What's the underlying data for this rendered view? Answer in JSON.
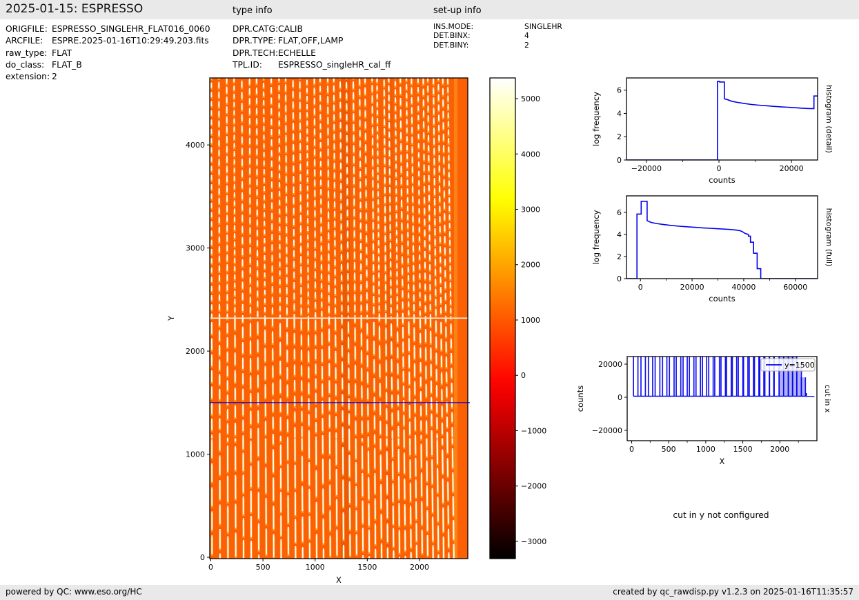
{
  "header": {
    "title": "2025-01-15: ESPRESSO",
    "type_info": "type info",
    "setup_info": "set-up info"
  },
  "file_info": {
    "rows": [
      {
        "label": "ORIGFILE:",
        "value": "ESPRESSO_SINGLEHR_FLAT016_0060"
      },
      {
        "label": "ARCFILE:",
        "value": "ESPRE.2025-01-16T10:29:49.203.fits"
      },
      {
        "label": "raw_type:",
        "value": "FLAT"
      },
      {
        "label": "do_class:",
        "value": "FLAT_B"
      },
      {
        "label": "extension:",
        "value": "2"
      }
    ]
  },
  "type_info": {
    "rows": [
      {
        "label": "DPR.CATG:",
        "value": "CALIB"
      },
      {
        "label": "DPR.TYPE:",
        "value": "FLAT,OFF,LAMP"
      },
      {
        "label": "DPR.TECH:",
        "value": "ECHELLE"
      },
      {
        "label": "TPL.ID:",
        "value": "ESPRESSO_singleHR_cal_ff"
      }
    ]
  },
  "setup_info": {
    "rows": [
      {
        "label": "INS.MODE:",
        "value": "SINGLEHR"
      },
      {
        "label": "DET.BINX:",
        "value": "4"
      },
      {
        "label": "DET.BINY:",
        "value": "2"
      }
    ]
  },
  "footer": {
    "left": "powered by QC: www.eso.org/HC",
    "right": "created by qc_rawdisp.py v1.2.3 on 2025-01-16T11:35:57"
  },
  "colors": {
    "line_blue": "#0000ee",
    "image_orange": "#fb6005",
    "stripe_white": "#ffffff",
    "stripe_yellow": "#ffc832",
    "band_gray": "#e9e9e9"
  },
  "chart_data": [
    {
      "id": "raw_image",
      "type": "heatmap",
      "xlabel": "X",
      "ylabel": "Y",
      "xlim": [
        -10,
        2463
      ],
      "ylim": [
        -13,
        4650
      ],
      "x_ticks": [
        0,
        500,
        1000,
        1500,
        2000
      ],
      "y_ticks": [
        0,
        1000,
        2000,
        3000,
        4000
      ],
      "overlays": [
        {
          "name": "cut-line",
          "y": 1500,
          "color": "#0000dd"
        },
        {
          "name": "detector-gap",
          "y": 2320,
          "color": "#fff6e6"
        }
      ],
      "pattern": {
        "description": "echelle flat-field orders: dashed white/yellow vertical stripes on orange background",
        "n_stripes": 38,
        "x_first": 12,
        "x_last": 2330,
        "background_counts": 1100
      }
    },
    {
      "id": "colorbar",
      "type": "colorbar",
      "colormap": "hot",
      "vmin": -3312,
      "vmax": 5374,
      "ticks": [
        5000,
        4000,
        3000,
        2000,
        1000,
        0,
        -1000,
        -2000,
        -3000
      ]
    },
    {
      "id": "histogram_detail",
      "type": "line",
      "title_right": "histogram (detail)",
      "xlabel": "counts",
      "ylabel": "log frequency",
      "xlim": [
        -25500,
        27200
      ],
      "ylim": [
        0,
        7.05
      ],
      "x_ticks": [
        -20000,
        0,
        20000
      ],
      "x_minor_ticks": [
        -10000,
        10000
      ],
      "y_ticks": [
        0,
        2,
        4,
        6
      ],
      "line_color": "#0000ee",
      "points": [
        [
          -25500,
          0
        ],
        [
          -400,
          0
        ],
        [
          -400,
          6.75
        ],
        [
          200,
          6.75
        ],
        [
          200,
          6.7
        ],
        [
          1500,
          6.7
        ],
        [
          1500,
          5.25
        ],
        [
          2200,
          5.2
        ],
        [
          3500,
          5.05
        ],
        [
          5000,
          4.95
        ],
        [
          7000,
          4.85
        ],
        [
          9000,
          4.77
        ],
        [
          11000,
          4.71
        ],
        [
          13000,
          4.66
        ],
        [
          15000,
          4.61
        ],
        [
          17000,
          4.57
        ],
        [
          19000,
          4.53
        ],
        [
          21000,
          4.49
        ],
        [
          23000,
          4.45
        ],
        [
          25000,
          4.42
        ],
        [
          26200,
          4.42
        ],
        [
          26200,
          5.5
        ],
        [
          27200,
          5.5
        ]
      ]
    },
    {
      "id": "histogram_full",
      "type": "line",
      "title_right": "histogram (full)",
      "xlabel": "counts",
      "ylabel": "log frequency",
      "xlim": [
        -5400,
        68600
      ],
      "ylim": [
        0,
        7.5
      ],
      "x_ticks": [
        0,
        20000,
        40000,
        60000
      ],
      "x_minor_ticks": [
        10000,
        30000,
        50000
      ],
      "y_ticks": [
        0,
        2,
        4,
        6
      ],
      "line_color": "#0000ee",
      "points": [
        [
          -5400,
          0
        ],
        [
          -1350,
          0
        ],
        [
          -1350,
          5.85
        ],
        [
          300,
          5.85
        ],
        [
          300,
          7.0
        ],
        [
          2600,
          7.0
        ],
        [
          2600,
          5.25
        ],
        [
          4000,
          5.1
        ],
        [
          6000,
          5.0
        ],
        [
          9000,
          4.9
        ],
        [
          12000,
          4.82
        ],
        [
          15000,
          4.75
        ],
        [
          18000,
          4.7
        ],
        [
          21000,
          4.65
        ],
        [
          24000,
          4.6
        ],
        [
          27000,
          4.56
        ],
        [
          30000,
          4.52
        ],
        [
          33000,
          4.48
        ],
        [
          35000,
          4.45
        ],
        [
          37000,
          4.4
        ],
        [
          38500,
          4.35
        ],
        [
          39500,
          4.25
        ],
        [
          40500,
          4.1
        ],
        [
          41800,
          4.0
        ],
        [
          41800,
          3.85
        ],
        [
          42600,
          3.85
        ],
        [
          42600,
          3.3
        ],
        [
          43800,
          3.3
        ],
        [
          43800,
          2.3
        ],
        [
          45200,
          2.3
        ],
        [
          45200,
          0.9
        ],
        [
          46600,
          0.9
        ],
        [
          46600,
          0
        ],
        [
          68600,
          0
        ]
      ]
    },
    {
      "id": "cut_in_x",
      "type": "spikes",
      "title_right": "cut in x",
      "xlabel": "X",
      "ylabel": "counts",
      "xlim": [
        -60,
        2500
      ],
      "ylim": [
        -26250,
        24580
      ],
      "x_ticks": [
        0,
        500,
        1000,
        1500,
        2000
      ],
      "x_minor_ticks": [
        250,
        750,
        1250,
        1750,
        2250
      ],
      "y_ticks": [
        -20000,
        0,
        20000
      ],
      "legend": {
        "label": "y=1500",
        "color": "#0000ee"
      },
      "spikes": {
        "n_pairs": 30,
        "x_first": 55,
        "x_last": 2315,
        "pair_halfgap": 30,
        "short_tops": [
          21000,
          12000
        ],
        "bump": {
          "x": 2356,
          "top": 2500
        }
      },
      "baseline": [
        [
          25,
          620
        ],
        [
          2350,
          620
        ],
        [
          2360,
          520
        ],
        [
          2466,
          500
        ]
      ]
    },
    {
      "id": "cut_in_y",
      "type": "note",
      "text": "cut in y not configured"
    }
  ]
}
